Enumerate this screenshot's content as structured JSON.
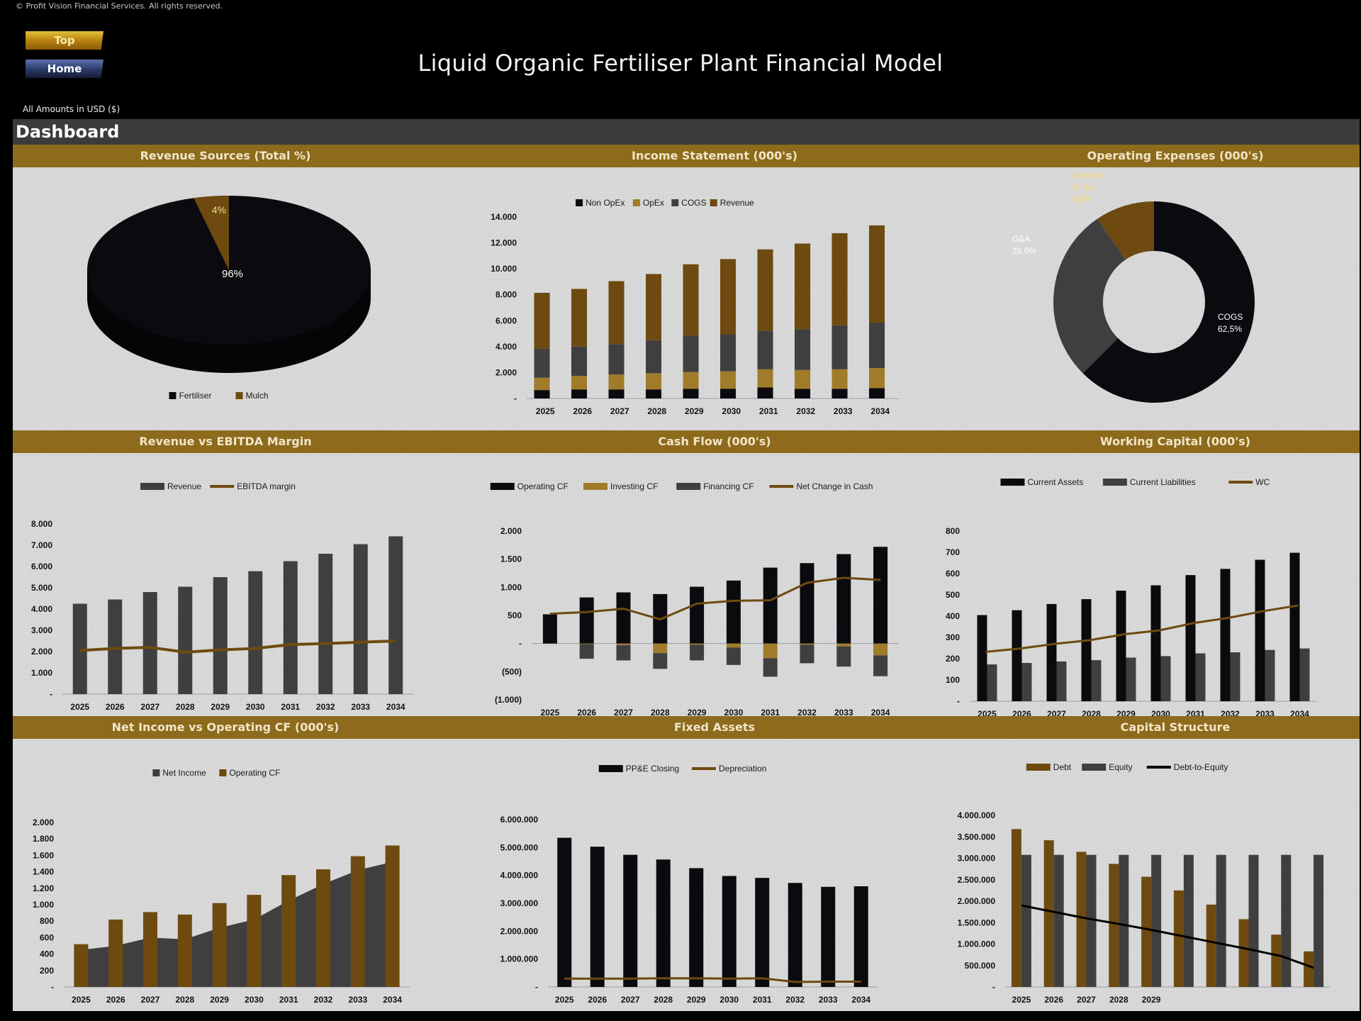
{
  "copyright": "© Profit Vision Financial Services. All rights reserved.",
  "nav": {
    "top_label": "Top",
    "home_label": "Home"
  },
  "title": "Liquid Organic Fertiliser Plant Financial Model",
  "amounts_note": "All Amounts in  USD ($)",
  "dashboard_label": "Dashboard",
  "colors": {
    "black": "#0b0b0f",
    "gold": "#6e4a10",
    "tan": "#a07c2a",
    "grey": "#3f3f3f",
    "header_gold": "#8d6a1c"
  },
  "chart_data": [
    {
      "id": "revenue_sources",
      "type": "pie",
      "title": "Revenue Sources (Total %)",
      "labels": [
        "Fertiliser",
        "Mulch"
      ],
      "values": [
        96,
        4
      ],
      "data_labels": [
        "96%",
        "4%"
      ],
      "legend": "bottom"
    },
    {
      "id": "income_statement",
      "type": "bar",
      "stacked": true,
      "title": "Income Statement (000's)",
      "categories": [
        "2025",
        "2026",
        "2027",
        "2028",
        "2029",
        "2030",
        "2031",
        "2032",
        "2033",
        "2034"
      ],
      "series": [
        {
          "name": "Non OpEx",
          "values": [
            650,
            700,
            700,
            700,
            750,
            750,
            850,
            750,
            750,
            800
          ]
        },
        {
          "name": "OpEx",
          "values": [
            950,
            1050,
            1150,
            1250,
            1300,
            1350,
            1400,
            1450,
            1500,
            1550
          ]
        },
        {
          "name": "COGS",
          "values": [
            2250,
            2250,
            2350,
            2550,
            2800,
            2850,
            2950,
            3150,
            3400,
            3500
          ]
        },
        {
          "name": "Revenue",
          "values": [
            4300,
            4450,
            4850,
            5100,
            5500,
            5800,
            6300,
            6600,
            7100,
            7500
          ]
        }
      ],
      "legend_order": [
        "Non OpEx",
        "OpEx",
        "COGS",
        "Revenue"
      ],
      "yticks": [
        "-",
        "2.000",
        "4.000",
        "6.000",
        "8.000",
        "10.000",
        "12.000",
        "14.000"
      ],
      "ylim": [
        0,
        14000
      ],
      "legend": "top"
    },
    {
      "id": "operating_expenses",
      "type": "pie",
      "donut": true,
      "title": "Operating Expenses (000's)",
      "labels": [
        "COGS",
        "G&A",
        "Interest & Tax"
      ],
      "values": [
        62.5,
        28.0,
        9.5
      ],
      "data_labels": [
        "COGS\n62,5%",
        "G&A\n28,0%",
        "Interest\n& Tax\n9,5%"
      ]
    },
    {
      "id": "revenue_vs_ebitda",
      "type": "bar",
      "title": "Revenue vs EBITDA Margin",
      "categories": [
        "2025",
        "2026",
        "2027",
        "2028",
        "2029",
        "2030",
        "2031",
        "2032",
        "2033",
        "2034"
      ],
      "series": [
        {
          "name": "Revenue",
          "kind": "bar",
          "values": [
            4250,
            4450,
            4800,
            5050,
            5500,
            5780,
            6250,
            6600,
            7050,
            7420
          ]
        },
        {
          "name": "EBITDA margin",
          "kind": "line",
          "values": [
            2050,
            2150,
            2200,
            1970,
            2080,
            2150,
            2330,
            2380,
            2440,
            2500
          ]
        }
      ],
      "yticks": [
        "-",
        "1.000",
        "2.000",
        "3.000",
        "4.000",
        "5.000",
        "6.000",
        "7.000",
        "8.000"
      ],
      "ylim": [
        0,
        8000
      ],
      "legend": "top"
    },
    {
      "id": "cash_flow",
      "type": "bar",
      "stacked": true,
      "title": "Cash Flow (000's)",
      "categories": [
        "2025",
        "2026",
        "2027",
        "2028",
        "2029",
        "2030",
        "2031",
        "2032",
        "2033",
        "2034"
      ],
      "series": [
        {
          "name": "Operating CF",
          "kind": "bar",
          "values": [
            520,
            820,
            910,
            880,
            1010,
            1120,
            1350,
            1430,
            1590,
            1720
          ]
        },
        {
          "name": "Investing CF",
          "kind": "bar",
          "values": [
            0,
            -10,
            -30,
            -170,
            -20,
            -70,
            -260,
            -20,
            -50,
            -210
          ]
        },
        {
          "name": "Financing CF",
          "kind": "bar",
          "values": [
            0,
            -260,
            -270,
            -280,
            -280,
            -310,
            -330,
            -330,
            -360,
            -370
          ]
        },
        {
          "name": "Net Change in Cash",
          "kind": "line",
          "values": [
            530,
            560,
            620,
            430,
            710,
            760,
            770,
            1080,
            1170,
            1130
          ]
        }
      ],
      "yticks": [
        "(1.000)",
        "(500)",
        "-",
        "500",
        "1.000",
        "1.500",
        "2.000"
      ],
      "ylim": [
        -1000,
        2000
      ],
      "legend": "top"
    },
    {
      "id": "working_capital",
      "type": "bar",
      "title": "Working Capital (000's)",
      "categories": [
        "2025",
        "2026",
        "2027",
        "2028",
        "2029",
        "2030",
        "2031",
        "2032",
        "2033",
        "2034"
      ],
      "series": [
        {
          "name": "Current Assets",
          "kind": "bar",
          "values": [
            405,
            428,
            457,
            480,
            520,
            545,
            593,
            622,
            665,
            698
          ]
        },
        {
          "name": "Current Liabilities",
          "kind": "bar",
          "values": [
            173,
            180,
            187,
            193,
            205,
            212,
            225,
            230,
            241,
            248
          ]
        },
        {
          "name": "WC",
          "kind": "line",
          "values": [
            232,
            248,
            270,
            287,
            315,
            333,
            368,
            392,
            424,
            450
          ]
        }
      ],
      "yticks": [
        "-",
        "100",
        "200",
        "300",
        "400",
        "500",
        "600",
        "700",
        "800"
      ],
      "ylim": [
        0,
        800
      ],
      "legend": "top"
    },
    {
      "id": "net_income_vs_ocf",
      "type": "bar",
      "title": "Net Income vs Operating CF (000's)",
      "categories": [
        "2025",
        "2026",
        "2027",
        "2028",
        "2029",
        "2030",
        "2031",
        "2032",
        "2033",
        "2034"
      ],
      "series": [
        {
          "name": "Net Income",
          "kind": "area",
          "values": [
            450,
            500,
            600,
            580,
            720,
            820,
            1050,
            1250,
            1420,
            1520
          ]
        },
        {
          "name": "Operating CF",
          "kind": "bar",
          "values": [
            520,
            820,
            910,
            880,
            1020,
            1120,
            1360,
            1430,
            1590,
            1720
          ]
        }
      ],
      "yticks": [
        "-",
        "200",
        "400",
        "600",
        "800",
        "1.000",
        "1.200",
        "1.400",
        "1.600",
        "1.800",
        "2.000"
      ],
      "ylim": [
        0,
        2000
      ],
      "legend": "top"
    },
    {
      "id": "fixed_assets",
      "type": "bar",
      "title": "Fixed Assets",
      "categories": [
        "2025",
        "2026",
        "2027",
        "2028",
        "2029",
        "2030",
        "2031",
        "2032",
        "2033",
        "2034"
      ],
      "series": [
        {
          "name": "PP&E Closing",
          "kind": "bar",
          "values": [
            5350000,
            5030000,
            4740000,
            4570000,
            4260000,
            3980000,
            3910000,
            3730000,
            3590000,
            3610000
          ]
        },
        {
          "name": "Depreciation",
          "kind": "line",
          "values": [
            300000,
            300000,
            300000,
            310000,
            310000,
            300000,
            310000,
            180000,
            190000,
            190000
          ]
        }
      ],
      "yticks": [
        "-",
        "1.000.000",
        "2.000.000",
        "3.000.000",
        "4.000.000",
        "5.000.000",
        "6.000.000"
      ],
      "ylim": [
        0,
        6000000
      ],
      "legend": "top"
    },
    {
      "id": "capital_structure",
      "type": "bar",
      "title": "Capital Structure",
      "categories": [
        "2025",
        "2026",
        "2027",
        "2028",
        "2029",
        "",
        "",
        "",
        "",
        ""
      ],
      "series": [
        {
          "name": "Debt",
          "kind": "bar",
          "values": [
            3680000,
            3420000,
            3150000,
            2870000,
            2570000,
            2250000,
            1920000,
            1580000,
            1220000,
            830000
          ]
        },
        {
          "name": "Equity",
          "kind": "bar",
          "values": [
            3080000,
            3080000,
            3080000,
            3080000,
            3080000,
            3080000,
            3080000,
            3080000,
            3080000,
            3080000
          ]
        },
        {
          "name": "Debt-to-Equity",
          "kind": "line",
          "values": [
            1900000,
            1750000,
            1600000,
            1470000,
            1330000,
            1180000,
            1030000,
            880000,
            720000,
            450000
          ]
        }
      ],
      "yticks": [
        "-",
        "500.000",
        "1.000.000",
        "1.500.000",
        "2.000.000",
        "2.500.000",
        "3.000.000",
        "3.500.000",
        "4.000.000"
      ],
      "ylim": [
        0,
        4000000
      ],
      "legend": "top"
    }
  ]
}
